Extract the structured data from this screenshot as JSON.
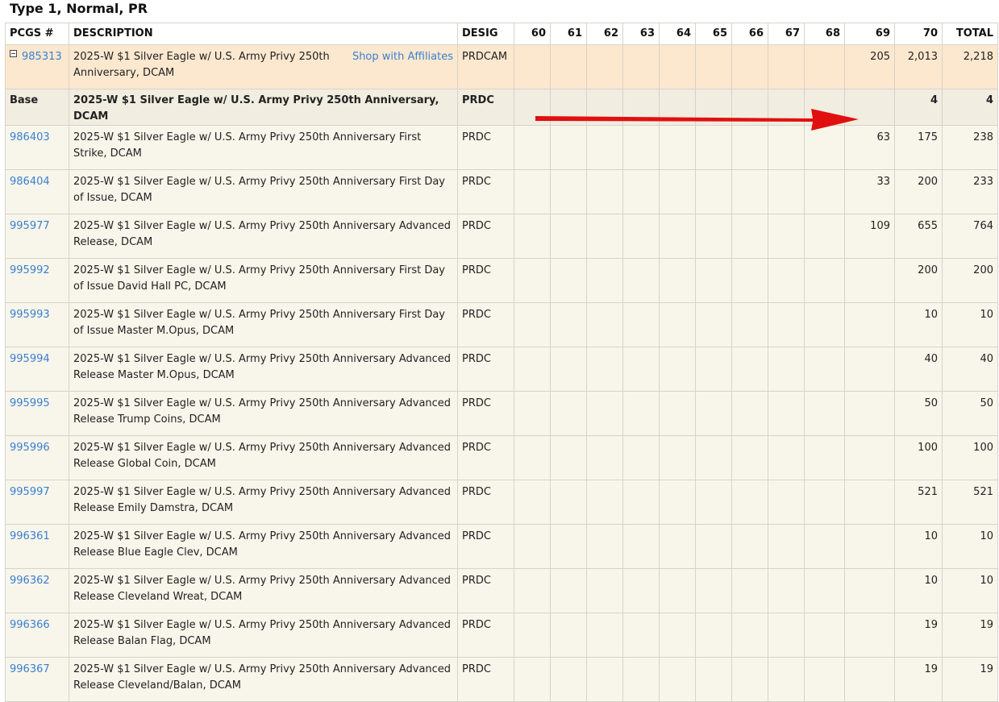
{
  "title": "Type 1, Normal, PR",
  "headers": [
    "PCGS #",
    "DESCRIPTION",
    "DESIG",
    "60",
    "61",
    "62",
    "63",
    "64",
    "65",
    "66",
    "67",
    "68",
    "69",
    "70",
    "TOTAL"
  ],
  "parent": {
    "pcgs": "985313",
    "description": "2025-W $1 Silver Eagle w/ U.S. Army Privy 250th Anniversary, DCAM",
    "shop_link": "Shop with Affiliates",
    "desig": "PRDCAM",
    "g69": "205",
    "g70": "2,013",
    "total": "2,218"
  },
  "base": {
    "label": "Base",
    "description": "2025-W $1 Silver Eagle w/ U.S. Army Privy 250th Anniversary, DCAM",
    "desig": "PRDC",
    "g69": "",
    "g70": "4",
    "total": "4"
  },
  "rows": [
    {
      "pcgs": "986403",
      "description": "2025-W $1 Silver Eagle w/ U.S. Army Privy 250th Anniversary First Strike, DCAM",
      "desig": "PRDC",
      "g69": "63",
      "g70": "175",
      "total": "238"
    },
    {
      "pcgs": "986404",
      "description": "2025-W $1 Silver Eagle w/ U.S. Army Privy 250th Anniversary First Day of Issue, DCAM",
      "desig": "PRDC",
      "g69": "33",
      "g70": "200",
      "total": "233"
    },
    {
      "pcgs": "995977",
      "description": "2025-W $1 Silver Eagle w/ U.S. Army Privy 250th Anniversary Advanced Release, DCAM",
      "desig": "PRDC",
      "g69": "109",
      "g70": "655",
      "total": "764"
    },
    {
      "pcgs": "995992",
      "description": "2025-W $1 Silver Eagle w/ U.S. Army Privy 250th Anniversary First Day of Issue David Hall PC, DCAM",
      "desig": "PRDC",
      "g69": "",
      "g70": "200",
      "total": "200"
    },
    {
      "pcgs": "995993",
      "description": "2025-W $1 Silver Eagle w/ U.S. Army Privy 250th Anniversary First Day of Issue Master M.Opus, DCAM",
      "desig": "PRDC",
      "g69": "",
      "g70": "10",
      "total": "10"
    },
    {
      "pcgs": "995994",
      "description": "2025-W $1 Silver Eagle w/ U.S. Army Privy 250th Anniversary Advanced Release Master M.Opus, DCAM",
      "desig": "PRDC",
      "g69": "",
      "g70": "40",
      "total": "40"
    },
    {
      "pcgs": "995995",
      "description": "2025-W $1 Silver Eagle w/ U.S. Army Privy 250th Anniversary Advanced Release Trump Coins, DCAM",
      "desig": "PRDC",
      "g69": "",
      "g70": "50",
      "total": "50"
    },
    {
      "pcgs": "995996",
      "description": "2025-W $1 Silver Eagle w/ U.S. Army Privy 250th Anniversary Advanced Release Global Coin, DCAM",
      "desig": "PRDC",
      "g69": "",
      "g70": "100",
      "total": "100"
    },
    {
      "pcgs": "995997",
      "description": "2025-W $1 Silver Eagle w/ U.S. Army Privy 250th Anniversary Advanced Release Emily Damstra, DCAM",
      "desig": "PRDC",
      "g69": "",
      "g70": "521",
      "total": "521"
    },
    {
      "pcgs": "996361",
      "description": "2025-W $1 Silver Eagle w/ U.S. Army Privy 250th Anniversary Advanced Release Blue Eagle Clev, DCAM",
      "desig": "PRDC",
      "g69": "",
      "g70": "10",
      "total": "10"
    },
    {
      "pcgs": "996362",
      "description": "2025-W $1 Silver Eagle w/ U.S. Army Privy 250th Anniversary Advanced Release Cleveland Wreat, DCAM",
      "desig": "PRDC",
      "g69": "",
      "g70": "10",
      "total": "10"
    },
    {
      "pcgs": "996366",
      "description": "2025-W $1 Silver Eagle w/ U.S. Army Privy 250th Anniversary Advanced Release Balan Flag, DCAM",
      "desig": "PRDC",
      "g69": "",
      "g70": "19",
      "total": "19"
    },
    {
      "pcgs": "996367",
      "description": "2025-W $1 Silver Eagle w/ U.S. Army Privy 250th Anniversary Advanced Release Cleveland/Balan, DCAM",
      "desig": "PRDC",
      "g69": "",
      "g70": "19",
      "total": "19"
    }
  ],
  "colors": {
    "link": "#3a7fd1",
    "parent_row": "#fce8cf",
    "arrow": "#e01010"
  },
  "icons": {
    "expand_toggle": "collapse-minus-icon",
    "annotation": "red-arrow-icon"
  }
}
